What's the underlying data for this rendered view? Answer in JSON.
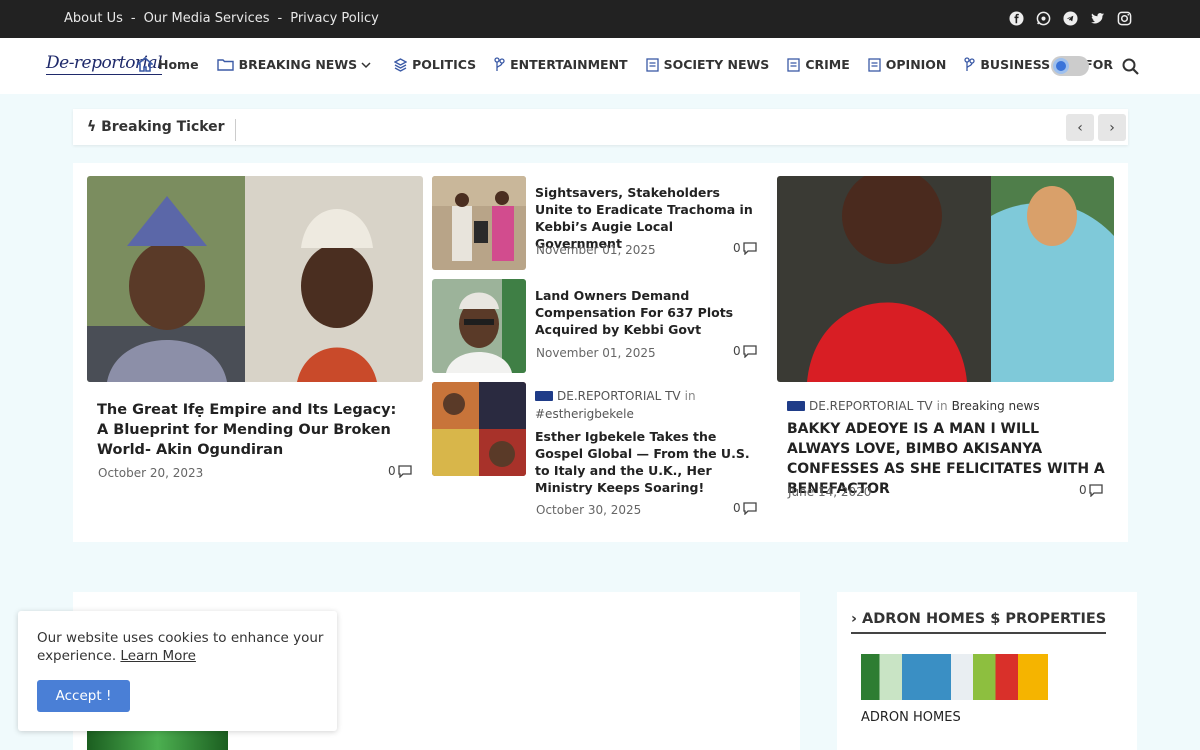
{
  "topbar": {
    "links": [
      "About Us",
      "Our Media Services",
      "Privacy Policy"
    ],
    "separator": "-",
    "social_icons": [
      "facebook-icon",
      "whatsapp-icon",
      "telegram-icon",
      "twitter-icon",
      "instagram-icon"
    ]
  },
  "header": {
    "logo": "De-reportorial",
    "nav": [
      {
        "label": "Home",
        "icon": "home-icon"
      },
      {
        "label": "BREAKING NEWS",
        "icon": "folder-icon",
        "dropdown": true
      },
      {
        "label": "POLITICS",
        "icon": "layers-icon"
      },
      {
        "label": "ENTERTAINMENT",
        "icon": "branch-icon"
      },
      {
        "label": "SOCIETY NEWS",
        "icon": "document-icon"
      },
      {
        "label": "CRIME",
        "icon": "document-icon"
      },
      {
        "label": "OPINION",
        "icon": "document-icon"
      },
      {
        "label": "BUSINESS",
        "icon": "branch-icon"
      },
      {
        "label": "FOR",
        "icon": "branch-icon"
      }
    ]
  },
  "ticker": {
    "label": "Breaking Ticker",
    "prev": "‹",
    "next": "›"
  },
  "featured": {
    "main": {
      "title": "The Great Ifẹ Empire and Its Legacy: A Blueprint for Mending Our Broken World- Akin Ogundiran",
      "date": "October 20, 2023",
      "comments": "0"
    },
    "list": [
      {
        "title": "Sightsavers, Stakeholders Unite to Eradicate Trachoma in Kebbi’s Augie Local Government",
        "date": "November 01, 2025",
        "comments": "0"
      },
      {
        "title": "Land Owners Demand Compensation For 637 Plots Acquired by Kebbi Govt",
        "date": "November 01, 2025",
        "comments": "0"
      },
      {
        "author": "DE.REPORTORIAL TV",
        "in": "in",
        "category": "#estherigbekele",
        "title": "Esther Igbekele Takes the Gospel Global — From the U.S. to Italy and the U.K., Her Ministry Keeps Soaring!",
        "date": "October 30, 2025",
        "comments": "0"
      }
    ],
    "right": {
      "author": "DE.REPORTORIAL TV",
      "in": "in",
      "category": "Breaking news",
      "title": "BAKKY ADEOYE IS A MAN I WILL ALWAYS LOVE, BIMBO AKISANYA CONFESSES AS SHE FELICITATES WITH A BENEFACTOR",
      "date": "June 14, 2020",
      "comments": "0"
    }
  },
  "sidebar": {
    "title": "ADRON HOMES $ PROPERTIES",
    "caption": "ADRON HOMES"
  },
  "cookie": {
    "text": "Our website uses cookies to enhance your experience.",
    "link": "Learn More",
    "accept": "Accept !"
  }
}
